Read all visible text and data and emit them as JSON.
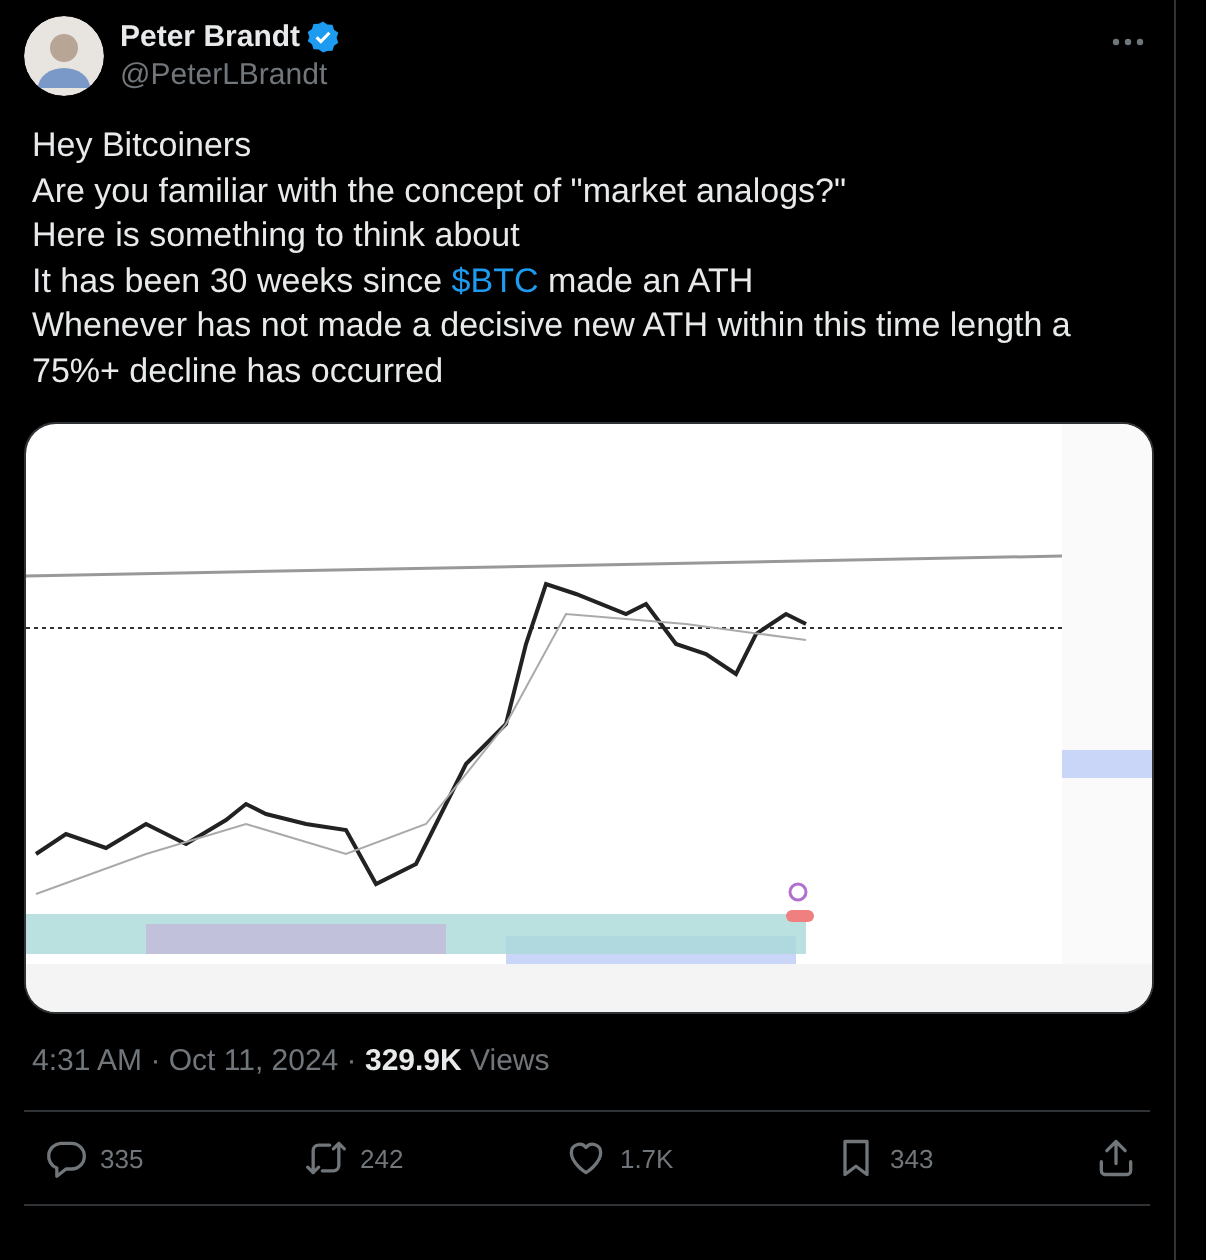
{
  "author": {
    "name": "Peter Brandt",
    "verified": true,
    "handle": "@PeterLBrandt"
  },
  "body": [
    {
      "text": "Hey Bitcoiners"
    },
    {
      "text": "Are you familiar with the concept of \"market analogs?\""
    },
    {
      "text": "Here is something to think about"
    },
    {
      "text": "It has been 30 weeks since ",
      "link": "$BTC",
      "after": " made an ATH"
    },
    {
      "text": "Whenever has not made a decisive new ATH within this time length a 75%+ decline has occurred"
    }
  ],
  "meta": "4:31 AM · Oct 11, 2024 · **329.9K** Views",
  "actions": [
    {
      "kind": "reply",
      "count": "335"
    },
    {
      "kind": "repost",
      "count": "242"
    },
    {
      "kind": "like",
      "count": "1.7K"
    },
    {
      "kind": "bookmark",
      "count": "343"
    },
    {
      "kind": "share"
    }
  ]
}
